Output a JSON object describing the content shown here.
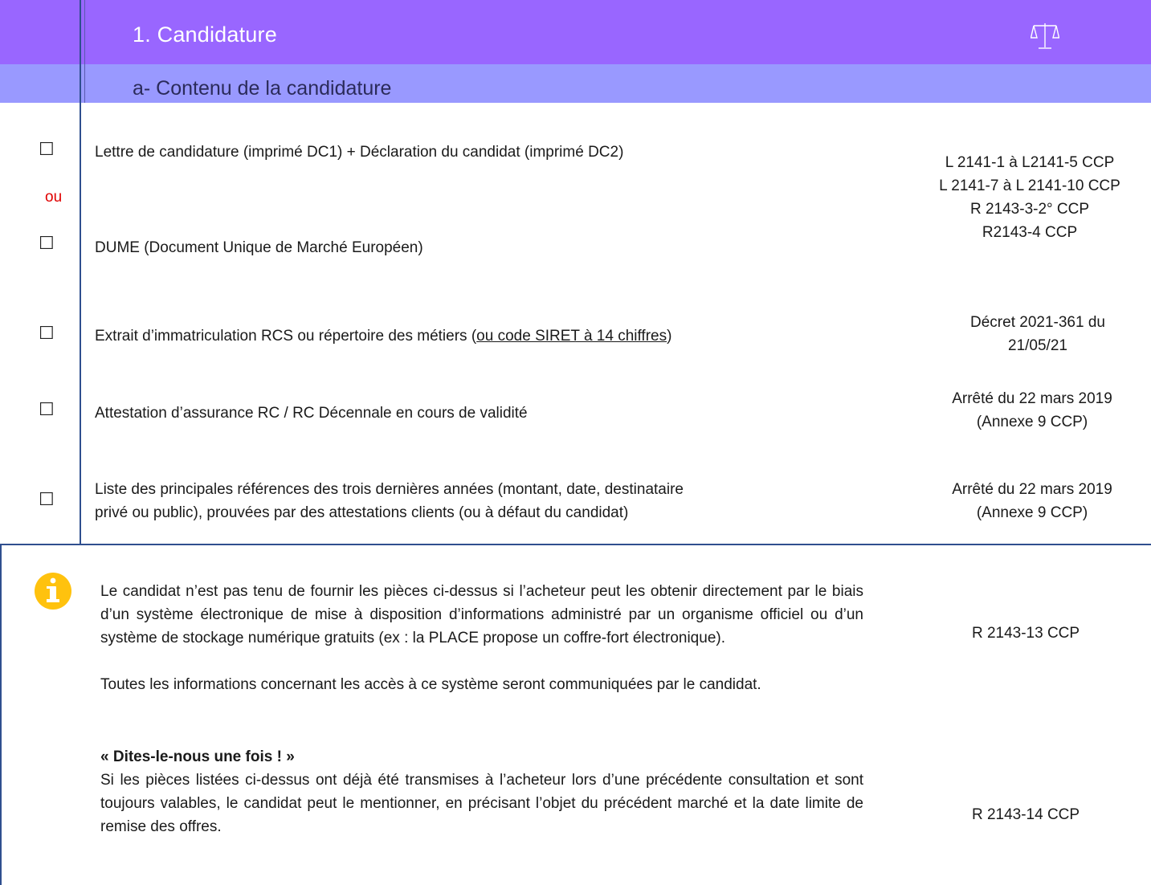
{
  "header": {
    "title": "1.  Candidature",
    "subtitle": "a-   Contenu de la candidature",
    "scale_icon": "scale-icon"
  },
  "checkbox_glyph": "☐",
  "or_label": "ou",
  "items": [
    {
      "label": "Lettre de candidature (imprimé DC1) + Déclaration du candidat (imprimé DC2)"
    },
    {
      "label": "DUME (Document Unique de Marché Européen)"
    },
    {
      "label_main": "Extrait d’immatriculation RCS ou répertoire des métiers (",
      "label_link": "ou code SIRET à 14 chiffres",
      "label_end": ")"
    },
    {
      "label": "Attestation d’assurance RC / RC Décennale en cours de validité"
    },
    {
      "line1": "Liste des principales références des trois dernières années (montant, date, destinataire",
      "line2": "privé ou public), prouvées par des attestations clients (ou à défaut du candidat)"
    }
  ],
  "references": {
    "dc_dume": [
      "L 2141-1 à L2141-5 CCP",
      "L 2141-7 à L 2141-10 CCP",
      "R 2143-3-2° CCP",
      "R2143-4 CCP"
    ],
    "rcs": [
      "Décret 2021-361 du",
      "21/05/21"
    ],
    "assurance": [
      "Arrêté du 22 mars 2019",
      "(Annexe 9 CCP)"
    ],
    "references_list": [
      "Arrêté du 22 mars 2019",
      "(Annexe 9 CCP)"
    ]
  },
  "info": {
    "icon": "info-icon",
    "paragraph1": "Le candidat n’est pas tenu de fournir les pièces ci-dessus si l’acheteur peut les obtenir directement par le biais d’un système électronique de mise à disposition d’informations administré par un organisme officiel ou d’un système de stockage numérique gratuits (ex : la PLACE propose un coffre-fort électronique).",
    "paragraph2": "Toutes les informations concernant les accès à ce système seront communiquées par le candidat.",
    "ref1": "R 2143-13 CCP",
    "bold_heading": "« Dites-le-nous une fois ! »",
    "paragraph3": "Si les pièces listées ci-dessus ont déjà été transmises à l’acheteur lors d’une précédente consultation et sont toujours valables, le candidat peut le mentionner, en précisant l’objet du précédent marché et la date limite de remise des offres.",
    "ref2": "R 2143-14 CCP"
  }
}
